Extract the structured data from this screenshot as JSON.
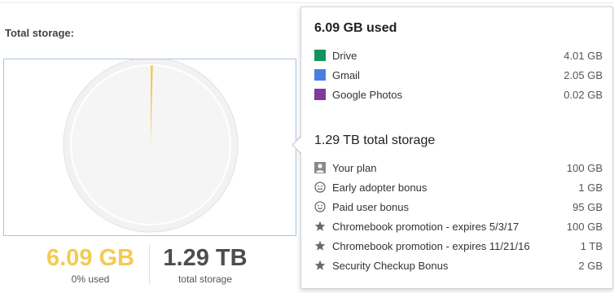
{
  "storage": {
    "title": "Total storage:"
  },
  "chart_data": {
    "type": "pie",
    "categories": [
      "Used",
      "Available"
    ],
    "values": [
      6.09,
      1314.79
    ],
    "colors": [
      "#f4cb52",
      "#f5f5f5"
    ]
  },
  "summary": {
    "used_value": "6.09 GB",
    "used_caption": "0% used",
    "total_value": "1.29 TB",
    "total_caption": "total storage"
  },
  "details": {
    "used_heading": "6.09 GB used",
    "used_items": [
      {
        "label": "Drive",
        "amount": "4.01 GB",
        "color": "#13935a"
      },
      {
        "label": "Gmail",
        "amount": "2.05 GB",
        "color": "#4a7fe0"
      },
      {
        "label": "Google Photos",
        "amount": "0.02 GB",
        "color": "#7b3c9e"
      }
    ],
    "total_heading": "1.29 TB total storage",
    "plan_items": [
      {
        "label": "Your plan",
        "amount": "100 GB",
        "icon": "person-icon"
      },
      {
        "label": "Early adopter bonus",
        "amount": "1 GB",
        "icon": "smiley-icon"
      },
      {
        "label": "Paid user bonus",
        "amount": "95 GB",
        "icon": "smiley-icon"
      },
      {
        "label": "Chromebook promotion - expires 5/3/17",
        "amount": "100 GB",
        "icon": "star-icon"
      },
      {
        "label": "Chromebook promotion - expires 11/21/16",
        "amount": "1 TB",
        "icon": "star-icon"
      },
      {
        "label": "Security Checkup Bonus",
        "amount": "2 GB",
        "icon": "star-icon"
      }
    ]
  }
}
